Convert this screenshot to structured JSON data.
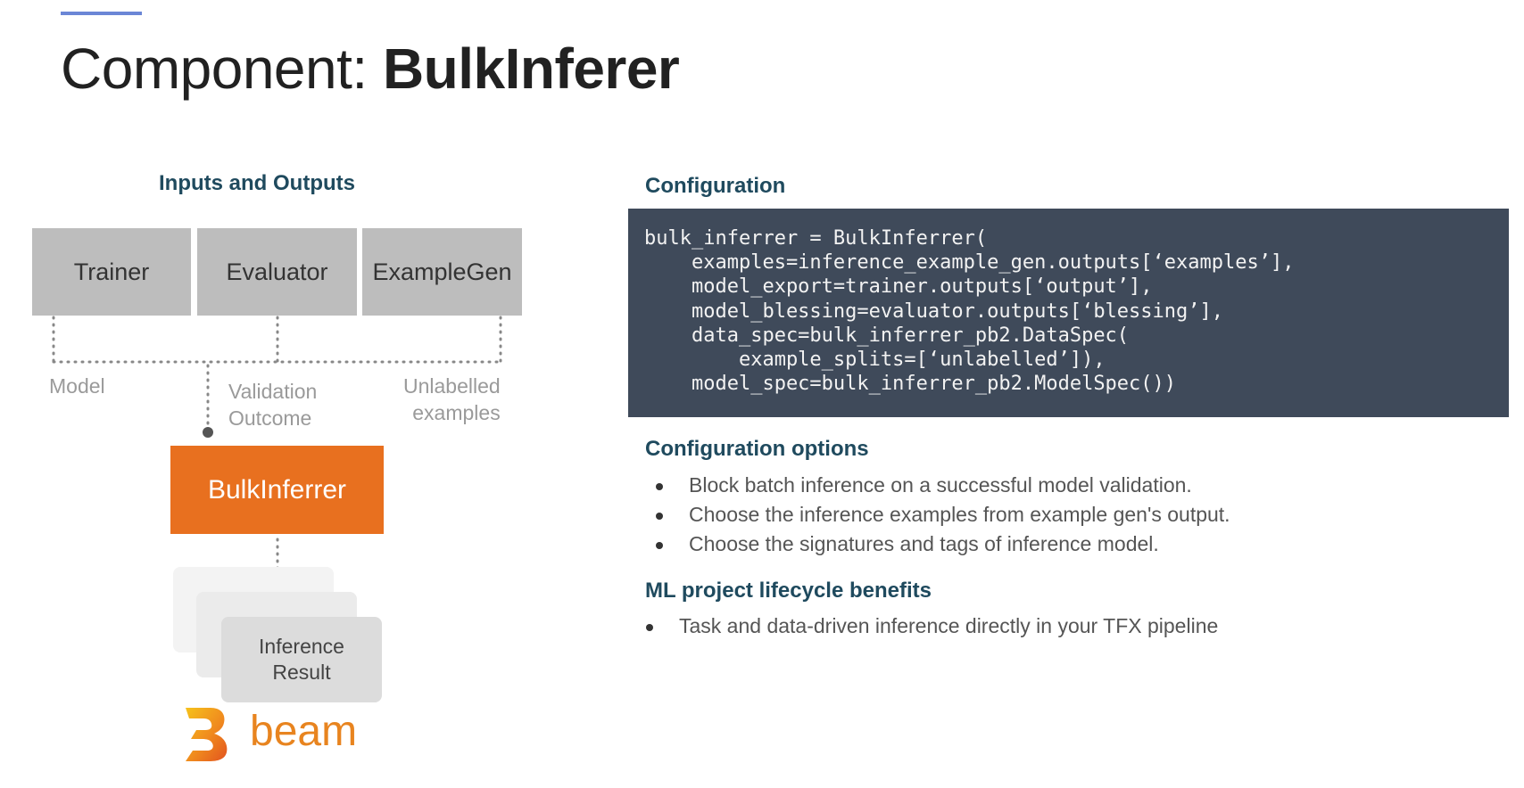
{
  "slide": {
    "title_prefix": "Component: ",
    "title_bold": "BulkInferer"
  },
  "diagram": {
    "heading": "Inputs and Outputs",
    "inputs": [
      {
        "label": "Trainer"
      },
      {
        "label": "Evaluator"
      },
      {
        "label": "ExampleGen"
      }
    ],
    "edge_labels": {
      "model": "Model",
      "validation_line1": "Validation",
      "validation_line2": "Outcome",
      "unlabelled_line1": "Unlabelled",
      "unlabelled_line2": "examples"
    },
    "component": "BulkInferrer",
    "output_line1": "Inference",
    "output_line2": "Result",
    "beam_text": "beam",
    "colors": {
      "input_box": "#bdbdbd",
      "component_box": "#e8701f",
      "beam": "#e8841f"
    }
  },
  "configuration": {
    "heading": "Configuration",
    "code_lines": [
      "bulk_inferrer = BulkInferrer(",
      "    examples=inference_example_gen.outputs[‘examples’],",
      "    model_export=trainer.outputs[‘output’],",
      "    model_blessing=evaluator.outputs[‘blessing’],",
      "    data_spec=bulk_inferrer_pb2.DataSpec(",
      "        example_splits=[‘unlabelled’]),",
      "    model_spec=bulk_inferrer_pb2.ModelSpec())"
    ],
    "panel_color": "#3f4a5a"
  },
  "options": {
    "heading": "Configuration options",
    "items": [
      "Block batch inference on a successful model validation.",
      "Choose the inference examples from example gen's output.",
      "Choose the signatures and tags of inference model."
    ]
  },
  "benefits": {
    "heading": "ML project lifecycle benefits",
    "items": [
      "Task and data-driven inference directly in your TFX pipeline"
    ]
  }
}
